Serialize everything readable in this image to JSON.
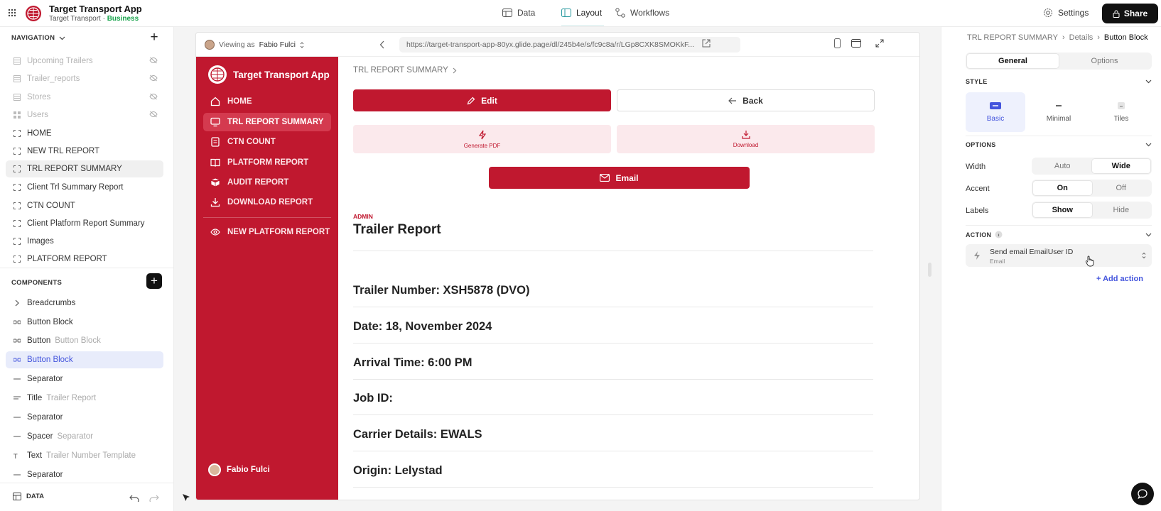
{
  "topbar": {
    "app_name": "Target Transport App",
    "app_sub_prefix": "Target Transport · ",
    "app_sub_plan": "Business",
    "tabs": [
      {
        "label": "Data"
      },
      {
        "label": "Layout"
      },
      {
        "label": "Workflows"
      }
    ],
    "settings_label": "Settings",
    "share_label": "Share"
  },
  "left": {
    "navigation_header": "NAVIGATION",
    "nav_items": [
      {
        "label": "Upcoming Trailers"
      },
      {
        "label": "Trailer_reports"
      },
      {
        "label": "Stores"
      },
      {
        "label": "Users"
      },
      {
        "label": "HOME"
      },
      {
        "label": "NEW TRL REPORT"
      },
      {
        "label": "TRL REPORT SUMMARY"
      },
      {
        "label": "Client Trl Summary Report"
      },
      {
        "label": "CTN COUNT"
      },
      {
        "label": "Client Platform Report Summary"
      },
      {
        "label": "Images"
      },
      {
        "label": "PLATFORM REPORT"
      }
    ],
    "components_header": "COMPONENTS",
    "components": [
      {
        "label": "Breadcrumbs",
        "sub": ""
      },
      {
        "label": "Button Block",
        "sub": ""
      },
      {
        "label": "Button",
        "sub": "Button Block"
      },
      {
        "label": "Button Block",
        "sub": ""
      },
      {
        "label": "Separator",
        "sub": ""
      },
      {
        "label": "Title",
        "sub": "Trailer Report"
      },
      {
        "label": "Separator",
        "sub": ""
      },
      {
        "label": "Spacer",
        "sub": "Separator"
      },
      {
        "label": "Text",
        "sub": "Trailer Number Template"
      },
      {
        "label": "Separator",
        "sub": ""
      }
    ],
    "bottom_label": "DATA"
  },
  "preview": {
    "viewing_prefix": "Viewing as",
    "viewing_user": "Fabio Fulci",
    "url": "https://target-transport-app-80yx.glide.page/dl/245b4e/s/fc9c8a/r/LGp8CXK8SMOKkF...",
    "sidebar": {
      "brand": "Target Transport App",
      "links": [
        {
          "label": "HOME"
        },
        {
          "label": "TRL REPORT SUMMARY"
        },
        {
          "label": "CTN COUNT"
        },
        {
          "label": "PLATFORM REPORT"
        },
        {
          "label": "AUDIT REPORT"
        },
        {
          "label": "DOWNLOAD REPORT"
        },
        {
          "label": "NEW PLATFORM REPORT"
        }
      ],
      "user": "Fabio Fulci"
    },
    "breadcrumb": "TRL REPORT SUMMARY",
    "edit_label": "Edit",
    "back_label": "Back",
    "generate_pdf_label": "Generate PDF",
    "download_label": "Download",
    "email_label": "Email",
    "admin_label": "ADMIN",
    "title": "Trailer Report",
    "fields": [
      "Trailer Number: XSH5878  (DVO)",
      "Date: 18, November 2024",
      "Arrival Time: 6:00 PM",
      "Job ID:",
      "Carrier Details: EWALS",
      "Origin: Lelystad"
    ]
  },
  "right": {
    "crumbs": [
      "TRL REPORT SUMMARY",
      "Details",
      "Button Block"
    ],
    "tabs": [
      {
        "label": "General"
      },
      {
        "label": "Options"
      }
    ],
    "style_header": "STYLE",
    "styles": [
      {
        "label": "Basic"
      },
      {
        "label": "Minimal"
      },
      {
        "label": "Tiles"
      }
    ],
    "options_header": "OPTIONS",
    "width_label": "Width",
    "width_opts": [
      "Auto",
      "Wide"
    ],
    "accent_label": "Accent",
    "accent_opts": [
      "On",
      "Off"
    ],
    "labels_label": "Labels",
    "labels_opts": [
      "Show",
      "Hide"
    ],
    "action_header": "ACTION",
    "action_title": "Send email EmailUser ID",
    "action_sub": "Email",
    "add_action": "Add action"
  },
  "colors": {
    "accent": "#c0182f",
    "selection_blue": "#4455dd",
    "business_green": "#16a34a"
  }
}
